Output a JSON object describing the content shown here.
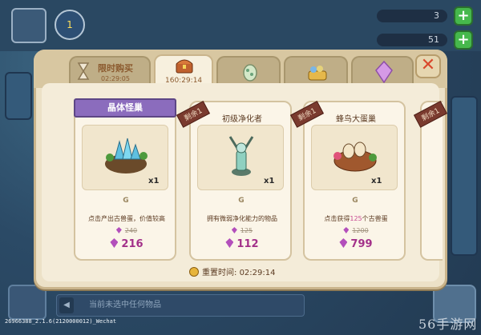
{
  "hud": {
    "resource1": "3",
    "resource2": "51",
    "level_badge": "1"
  },
  "tabs": [
    {
      "title": "限时购买",
      "time": "02:29:05",
      "icon": "hourglass-icon"
    },
    {
      "title": "",
      "time": "160:29:14",
      "icon": "treasure-chest-icon"
    },
    {
      "title": "",
      "time": "",
      "icon": "egg-icon"
    },
    {
      "title": "",
      "time": "",
      "icon": "food-basket-icon"
    },
    {
      "title": "",
      "time": "",
      "icon": "purple-gem-icon"
    }
  ],
  "cards": [
    {
      "banner": "晶体怪巢",
      "ribbon": "",
      "name": "",
      "qty": "x1",
      "desc": "点击产出古兽蛋，价值较高",
      "desc_pre": "",
      "desc_num": "",
      "desc_post": "",
      "old_price": "240",
      "price": "216"
    },
    {
      "banner": "",
      "ribbon": "剩余1",
      "name": "初级净化者",
      "qty": "x1",
      "desc": "拥有微弱净化能力的物品",
      "desc_pre": "",
      "desc_num": "",
      "desc_post": "",
      "old_price": "125",
      "price": "112"
    },
    {
      "banner": "",
      "ribbon": "剩余1",
      "name": "蜂鸟大蛋巢",
      "qty": "x1",
      "desc": "",
      "desc_pre": "点击获得",
      "desc_num": "125",
      "desc_post": "个古兽蛋",
      "old_price": "1200",
      "price": "799"
    },
    {
      "banner": "",
      "ribbon": "剩余1",
      "name": "",
      "qty": "",
      "desc": "",
      "old_price": "",
      "price": ""
    }
  ],
  "reset": {
    "label": "重置时间:",
    "time": "02:29:14"
  },
  "bottom": {
    "hint": "当前未选中任何物品",
    "version": "26966388_2.1.6(2120000012)_Wechat",
    "watermark": "56手游网"
  },
  "colors": {
    "accent_purple": "#a33089",
    "panel": "#ece1c7",
    "close_red": "#d9482c"
  }
}
